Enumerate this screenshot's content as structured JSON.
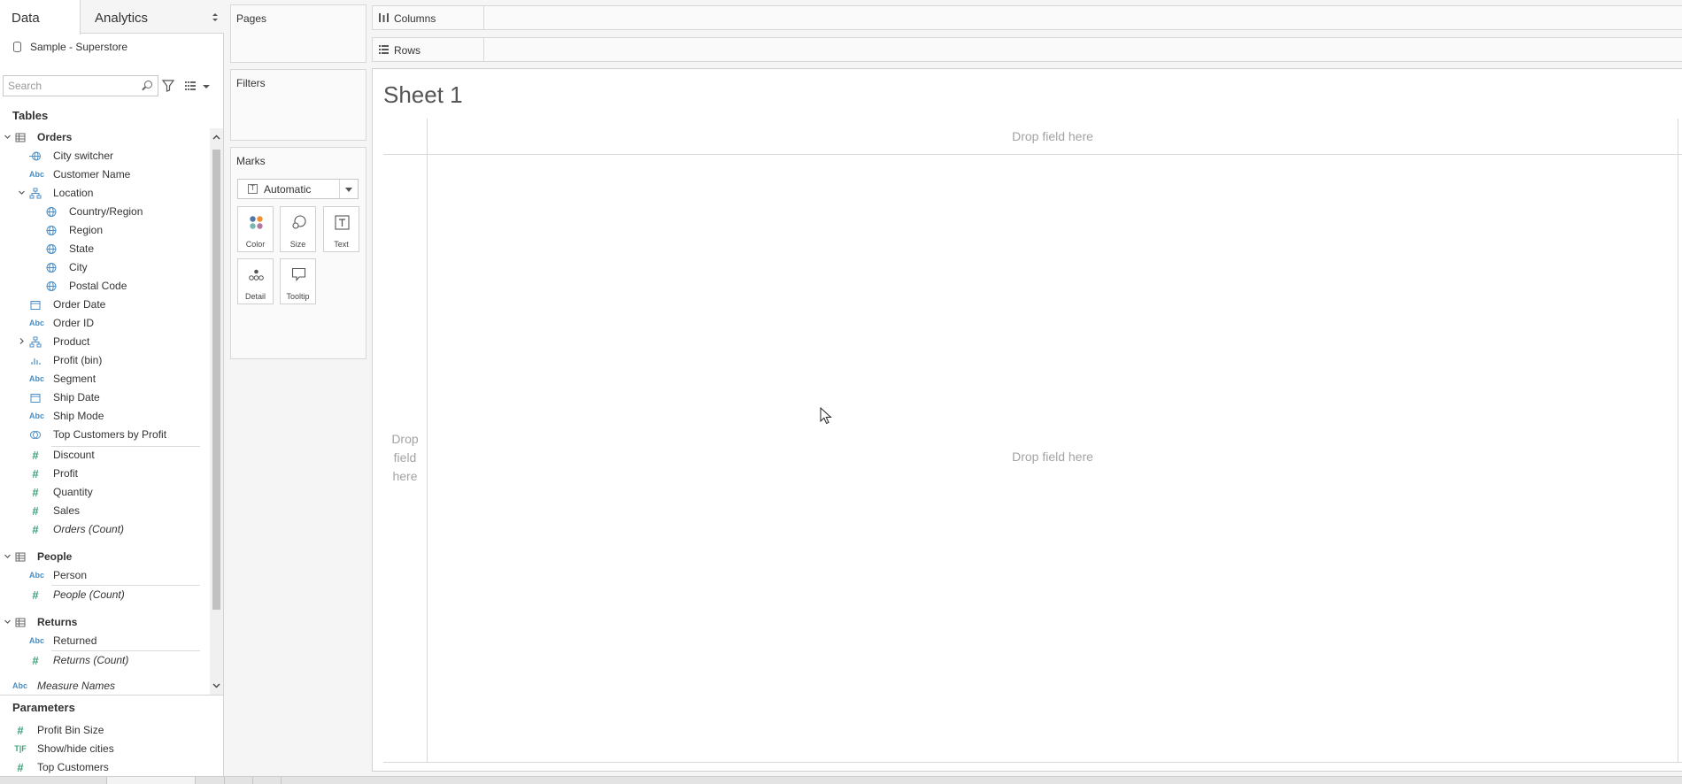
{
  "tabs": {
    "data": "Data",
    "analytics": "Analytics"
  },
  "datasource": {
    "name": "Sample - Superstore"
  },
  "search": {
    "placeholder": "Search"
  },
  "tables_heading": "Tables",
  "fields": [
    {
      "label": "Orders",
      "kind": "table",
      "icon": "table-icon"
    },
    {
      "label": "City switcher",
      "kind": "field",
      "icon": "calc-geo-icon"
    },
    {
      "label": "Customer Name",
      "kind": "field",
      "icon": "string-icon"
    },
    {
      "label": "Location",
      "kind": "field",
      "icon": "hierarchy-icon"
    },
    {
      "label": "Country/Region",
      "kind": "field",
      "icon": "globe-icon"
    },
    {
      "label": "Region",
      "kind": "field",
      "icon": "globe-icon"
    },
    {
      "label": "State",
      "kind": "field",
      "icon": "globe-icon"
    },
    {
      "label": "City",
      "kind": "field",
      "icon": "globe-icon"
    },
    {
      "label": "Postal Code",
      "kind": "field",
      "icon": "globe-icon"
    },
    {
      "label": "Order Date",
      "kind": "field",
      "icon": "calendar-icon"
    },
    {
      "label": "Order ID",
      "kind": "field",
      "icon": "string-icon"
    },
    {
      "label": "Product",
      "kind": "field",
      "icon": "hierarchy-icon"
    },
    {
      "label": "Profit (bin)",
      "kind": "field",
      "icon": "bin-icon"
    },
    {
      "label": "Segment",
      "kind": "field",
      "icon": "string-icon"
    },
    {
      "label": "Ship Date",
      "kind": "field",
      "icon": "calendar-icon"
    },
    {
      "label": "Ship Mode",
      "kind": "field",
      "icon": "string-icon"
    },
    {
      "label": "Top Customers by Profit",
      "kind": "field",
      "icon": "set-icon"
    },
    {
      "label": "Discount",
      "kind": "measure",
      "icon": "number-icon"
    },
    {
      "label": "Profit",
      "kind": "measure",
      "icon": "number-icon"
    },
    {
      "label": "Quantity",
      "kind": "measure",
      "icon": "number-icon"
    },
    {
      "label": "Sales",
      "kind": "measure",
      "icon": "number-icon"
    },
    {
      "label": "Orders (Count)",
      "kind": "measure",
      "icon": "number-icon"
    },
    {
      "label": "People",
      "kind": "table",
      "icon": "table-icon"
    },
    {
      "label": "Person",
      "kind": "field",
      "icon": "string-icon"
    },
    {
      "label": "People (Count)",
      "kind": "measure",
      "icon": "number-icon"
    },
    {
      "label": "Returns",
      "kind": "table",
      "icon": "table-icon"
    },
    {
      "label": "Returned",
      "kind": "field",
      "icon": "string-icon"
    },
    {
      "label": "Returns (Count)",
      "kind": "measure",
      "icon": "number-icon"
    },
    {
      "label": "Measure Names",
      "kind": "field",
      "icon": "string-icon"
    }
  ],
  "parameters_heading": "Parameters",
  "parameters": [
    {
      "label": "Profit Bin Size",
      "icon": "number-icon"
    },
    {
      "label": "Show/hide cities",
      "icon": "string-param-icon"
    },
    {
      "label": "Top Customers",
      "icon": "number-icon"
    }
  ],
  "cards": {
    "pages": "Pages",
    "filters": "Filters",
    "marks": "Marks"
  },
  "marks": {
    "type": "Automatic",
    "buttons": {
      "color": "Color",
      "size": "Size",
      "text": "Text",
      "detail": "Detail",
      "tooltip": "Tooltip"
    }
  },
  "shelves": {
    "columns": "Columns",
    "rows": "Rows"
  },
  "sheet": {
    "title": "Sheet 1",
    "drop_top": "Drop field here",
    "drop_center": "Drop field here",
    "drop_left_line1": "Drop",
    "drop_left_line2": "field",
    "drop_left_line3": "here"
  },
  "colors": {
    "dimension": "#4c8ec3",
    "measure": "#3fa07a",
    "placeholder": "#a3a3a3"
  }
}
